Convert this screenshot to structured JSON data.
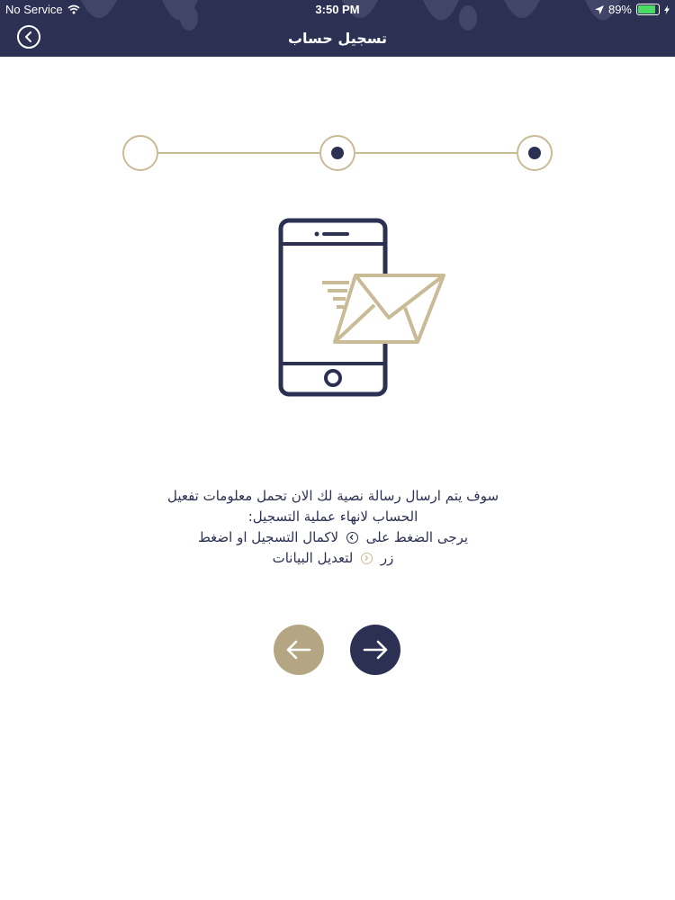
{
  "status_bar": {
    "carrier": "No Service",
    "time": "3:50 PM",
    "battery": "89%",
    "battery_level": 0.89
  },
  "nav": {
    "title": "تسجيل حساب"
  },
  "stepper": {
    "total_steps": 3,
    "completed_steps": 2
  },
  "instructions": {
    "line1": "سوف يتم ارسال رسالة  نصية لك الان تحمل معلومات تفعيل",
    "line2": "الحساب لانهاء عملية التسجيل:",
    "line3_part1": "يرجى الضغط على",
    "line3_part2": "لاكمال التسجيل  او اضغط",
    "line4_part1": "زر",
    "line4_part2": "لتعديل البيانات"
  },
  "colors": {
    "navy": "#2c3154",
    "gold": "#c9bb96",
    "gold_button": "#b5a683"
  },
  "icons": {
    "back": "chevron-left-circle-icon",
    "wifi": "wifi-icon",
    "location": "location-arrow-icon",
    "battery": "battery-icon",
    "phone_illustration": "phone-message-icon",
    "previous": "arrow-left-icon",
    "next": "arrow-right-icon"
  }
}
